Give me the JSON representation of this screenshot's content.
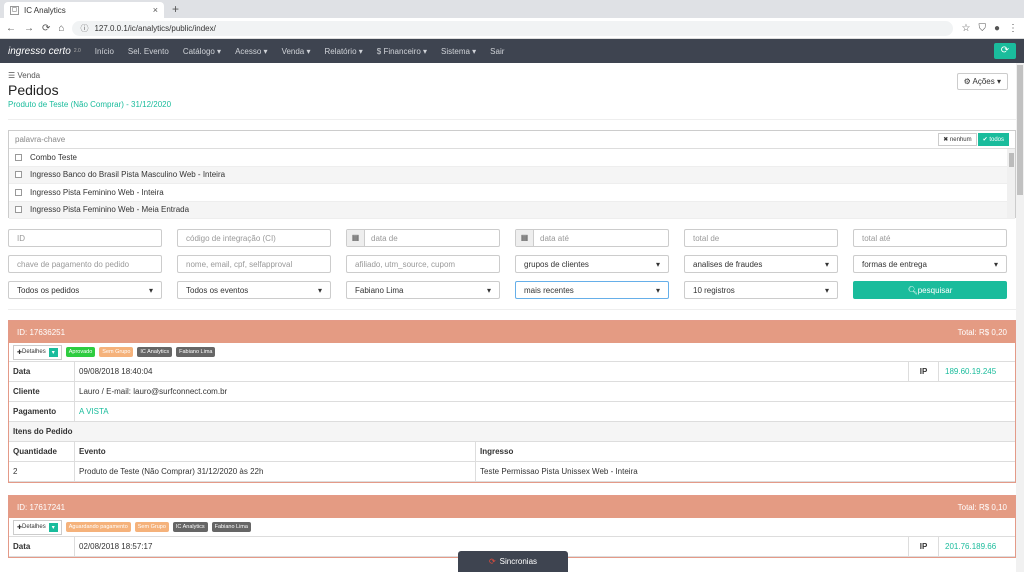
{
  "browser": {
    "tab_title": "IC Analytics",
    "url": "127.0.0.1/ic/analytics/public/index/"
  },
  "navbar": {
    "brand": "ingresso certo",
    "version": "2.0",
    "items": [
      "Início",
      "Sel. Evento",
      "Catálogo ▾",
      "Acesso ▾",
      "Venda ▾",
      "Relatório ▾",
      "$ Financeiro ▾",
      "Sistema ▾",
      "Sair"
    ]
  },
  "page": {
    "breadcrumb": "Venda",
    "title": "Pedidos",
    "subtitle": "Produto de Teste (Não Comprar) - 31/12/2020",
    "actions": "Ações ▾"
  },
  "filter": {
    "keyword_placeholder": "palavra-chave",
    "none": "nenhum",
    "all": "todos",
    "options": [
      "Combo Teste",
      "Ingresso Banco do Brasil Pista Masculino Web - Inteira",
      "Ingresso Pista Feminino Web - Inteira",
      "Ingresso Pista Feminino Web - Meia Entrada"
    ]
  },
  "fields": {
    "r1": [
      "ID",
      "código de integração (CI)",
      "data de",
      "data até",
      "total de",
      "total até"
    ],
    "r2": [
      "chave de pagamento do pedido",
      "nome, email, cpf, selfapproval",
      "afiliado, utm_source, cupom",
      "grupos de clientes",
      "analises de fraudes",
      "formas de entrega"
    ],
    "r3": [
      "Todos os pedidos",
      "Todos os eventos",
      "Fabiano Lima",
      "mais recentes",
      "10 registros"
    ],
    "search": "pesquisar"
  },
  "orders": [
    {
      "id": "ID: 17636251",
      "total": "Total: R$ 0,20",
      "details": "Detalhes",
      "badges": [
        {
          "t": "Aprovado",
          "c": "#2ecc40"
        },
        {
          "t": "Sem Grupo",
          "c": "#f5b27b"
        },
        {
          "t": "IC Analytics",
          "c": "#666"
        },
        {
          "t": "Fabiano Lima",
          "c": "#666"
        }
      ],
      "data_label": "Data",
      "data": "09/08/2018 18:40:04",
      "ip_label": "IP",
      "ip": "189.60.19.245",
      "cliente_label": "Cliente",
      "cliente": "Lauro / E-mail: lauro@surfconnect.com.br",
      "pag_label": "Pagamento",
      "pag": "A VISTA",
      "itens": "Itens do Pedido",
      "col_q": "Quantidade",
      "col_e": "Evento",
      "col_i": "Ingresso",
      "q": "2",
      "e": "Produto de Teste (Não Comprar) 31/12/2020 às 22h",
      "i": "Teste Permissao Pista Unissex Web - Inteira"
    },
    {
      "id": "ID: 17617241",
      "total": "Total: R$ 0,10",
      "details": "Detalhes",
      "badges": [
        {
          "t": "Aguardando pagamento",
          "c": "#f5b27b"
        },
        {
          "t": "Sem Grupo",
          "c": "#f5b27b"
        },
        {
          "t": "IC Analytics",
          "c": "#666"
        },
        {
          "t": "Fabiano Lima",
          "c": "#666"
        }
      ],
      "data_label": "Data",
      "data": "02/08/2018 18:57:17",
      "ip_label": "IP",
      "ip": "201.76.189.66"
    }
  ],
  "sync": "Sincronias"
}
